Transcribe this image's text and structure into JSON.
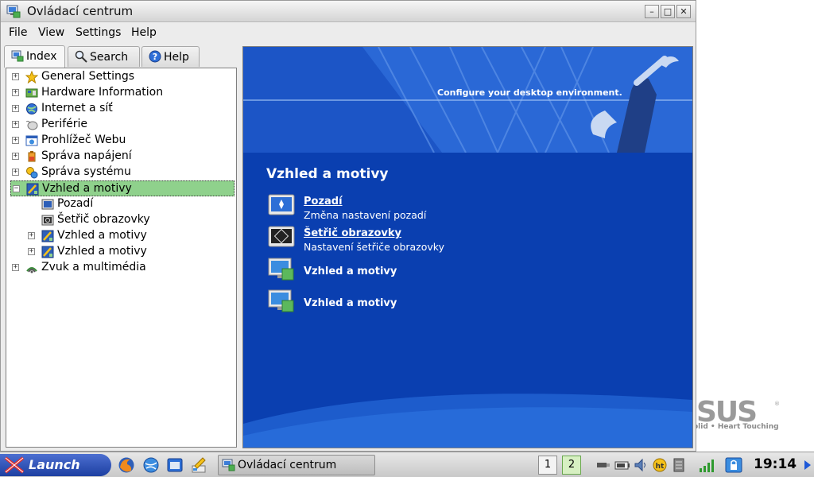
{
  "window": {
    "title": "Ovládací centrum"
  },
  "menu": [
    "File",
    "View",
    "Settings",
    "Help"
  ],
  "tabs": [
    {
      "label": "Index",
      "active": true
    },
    {
      "label": "Search",
      "active": false
    },
    {
      "label": "Help",
      "active": false
    }
  ],
  "tree": {
    "items": [
      {
        "label": "General Settings",
        "icon": "star-icon",
        "expander": "+",
        "level": 0
      },
      {
        "label": "Hardware Information",
        "icon": "hardware-icon",
        "expander": "+",
        "level": 0
      },
      {
        "label": "Internet a síť",
        "icon": "globe-icon",
        "expander": "+",
        "level": 0
      },
      {
        "label": "Periférie",
        "icon": "mouse-icon",
        "expander": "+",
        "level": 0
      },
      {
        "label": "Prohlížeč Webu",
        "icon": "browser-icon",
        "expander": "+",
        "level": 0
      },
      {
        "label": "Správa napájení",
        "icon": "power-icon",
        "expander": "+",
        "level": 0
      },
      {
        "label": "Správa systému",
        "icon": "system-icon",
        "expander": "+",
        "level": 0
      },
      {
        "label": "Vzhled a motivy",
        "icon": "appearance-icon",
        "expander": "−",
        "level": 0,
        "selected": true
      },
      {
        "label": "Pozadí",
        "icon": "wallpaper-icon",
        "expander": "",
        "level": 1
      },
      {
        "label": "Šetřič obrazovky",
        "icon": "screensaver-icon",
        "expander": "",
        "level": 1
      },
      {
        "label": "Vzhled a motivy",
        "icon": "appearance-icon",
        "expander": "+",
        "level": 1
      },
      {
        "label": "Vzhled a motivy",
        "icon": "appearance-icon",
        "expander": "+",
        "level": 1
      },
      {
        "label": "Zvuk a multimédia",
        "icon": "sound-icon",
        "expander": "+",
        "level": 0
      }
    ]
  },
  "content": {
    "banner_text": "Configure your desktop environment.",
    "section_title": "Vzhled a motivy",
    "items": [
      {
        "title": "Pozadí",
        "description": "Změna nastavení pozadí",
        "icon": "wallpaper-monitor-icon"
      },
      {
        "title": "Šetřič obrazovky",
        "description": "Nastavení šetřiče obrazovky",
        "icon": "screensaver-monitor-icon"
      },
      {
        "title": "Vzhled a motivy",
        "description": "",
        "icon": "monitor-theme-icon"
      },
      {
        "title": "Vzhled a motivy",
        "description": "",
        "icon": "monitor-theme-icon"
      }
    ]
  },
  "desktop": {
    "brand_tagline": "olid • Heart Touching"
  },
  "taskbar": {
    "launch_label": "Launch",
    "task_title": "Ovládací centrum",
    "desktops": [
      "1",
      "2"
    ],
    "active_desktop": "2",
    "clock": "19:14"
  },
  "colors": {
    "content_bg": "#0a3fb0",
    "selection": "#8fd18c",
    "launch_bg": "#1d3fa1"
  }
}
